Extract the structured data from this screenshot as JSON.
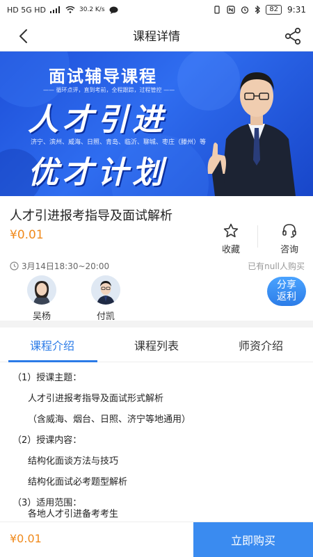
{
  "status_bar": {
    "left_text": "HD 5G HD",
    "speed": "30.2 K/s",
    "battery": "82",
    "time": "9:31"
  },
  "header": {
    "title": "课程详情"
  },
  "banner": {
    "heading": "面试辅导课程",
    "tagline": "—— 循环点评，直到考前，全程跟踪，过程管控 ——",
    "big_line_1": "人才引进",
    "cities": "济宁、滨州、威海、日照、青岛、临沂、聊城、枣庄（滕州）等",
    "big_line_2": "优才计划"
  },
  "course": {
    "title": "人才引进报考指导及面试解析",
    "price": "¥0.01",
    "time": "3月14日18:30~20:00",
    "bought": "已有null人购买"
  },
  "actions": {
    "favorite_label": "收藏",
    "consult_label": "咨询"
  },
  "teachers": [
    {
      "name": "吴杨"
    },
    {
      "name": "付凯"
    }
  ],
  "share_button": {
    "line1": "分享",
    "line2": "返利"
  },
  "tabs": [
    {
      "label": "课程介绍"
    },
    {
      "label": "课程列表"
    },
    {
      "label": "师资介绍"
    }
  ],
  "description": [
    "（1）授课主题：",
    "人才引进报考指导及面试形式解析",
    "（含威海、烟台、日照、济宁等地通用）",
    "（2）授课内容：",
    "结构化面谈方法与技巧",
    "结构化面试必考题型解析",
    "（3）适用范围：",
    "各地人才引进备考考生"
  ],
  "bottom": {
    "price": "¥0.01",
    "buy_label": "立即购买"
  },
  "colors": {
    "accent": "#2b7be7",
    "price": "#f08a1c",
    "buy": "#3a8bf0"
  }
}
